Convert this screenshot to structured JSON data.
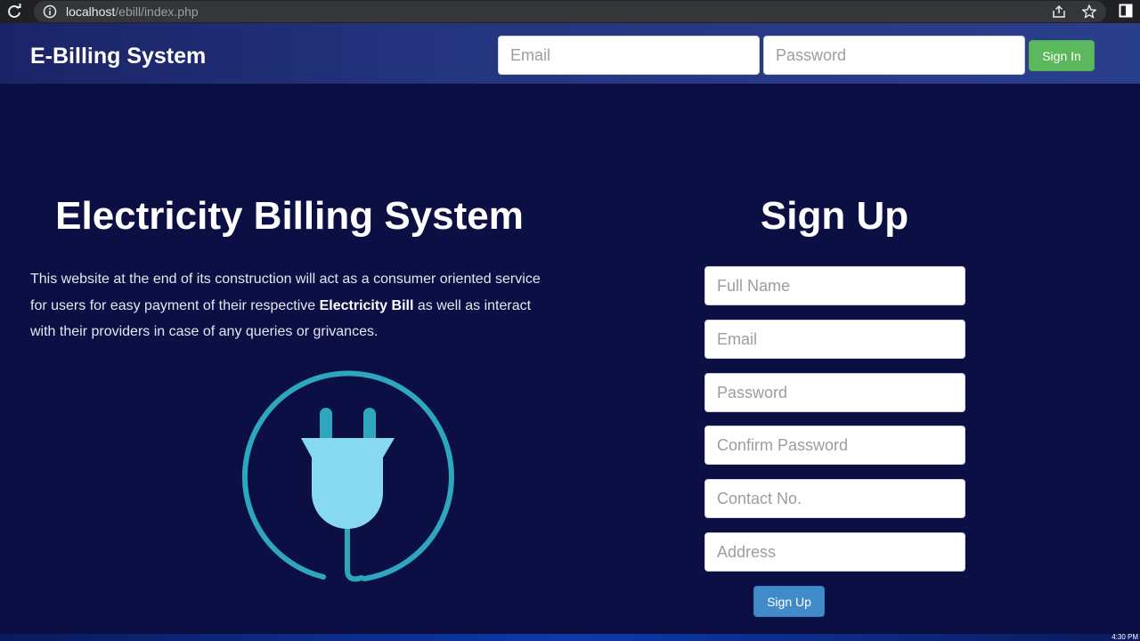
{
  "browser": {
    "url_host": "localhost",
    "url_path": "/ebill/index.php"
  },
  "header": {
    "brand": "E-Billing System",
    "email_placeholder": "Email",
    "password_placeholder": "Password",
    "signin_label": "Sign In"
  },
  "intro": {
    "title": "Electricity Billing System",
    "text_before": "This website at the end of its construction will act as a consumer oriented service for users for easy payment of their respective ",
    "text_bold": "Electricity Bill",
    "text_after": " as well as interact with their providers in case of any queries or grivances."
  },
  "signup": {
    "title": "Sign Up",
    "fields": {
      "full_name": "Full Name",
      "email": "Email",
      "password": "Password",
      "confirm_password": "Confirm Password",
      "contact": "Contact No.",
      "address": "Address"
    },
    "button_label": "Sign Up"
  },
  "taskbar": {
    "clock": "4:30 PM"
  },
  "colors": {
    "background": "#0b0f44",
    "header": "#24357f",
    "signin_button": "#5cb85c",
    "signup_button": "#428bca",
    "plug_fill": "#86d9ee",
    "plug_ring": "#2ea6bd"
  },
  "icons": [
    "reload-icon",
    "info-icon",
    "share-icon",
    "star-icon",
    "side-panel-icon",
    "plug-icon"
  ]
}
